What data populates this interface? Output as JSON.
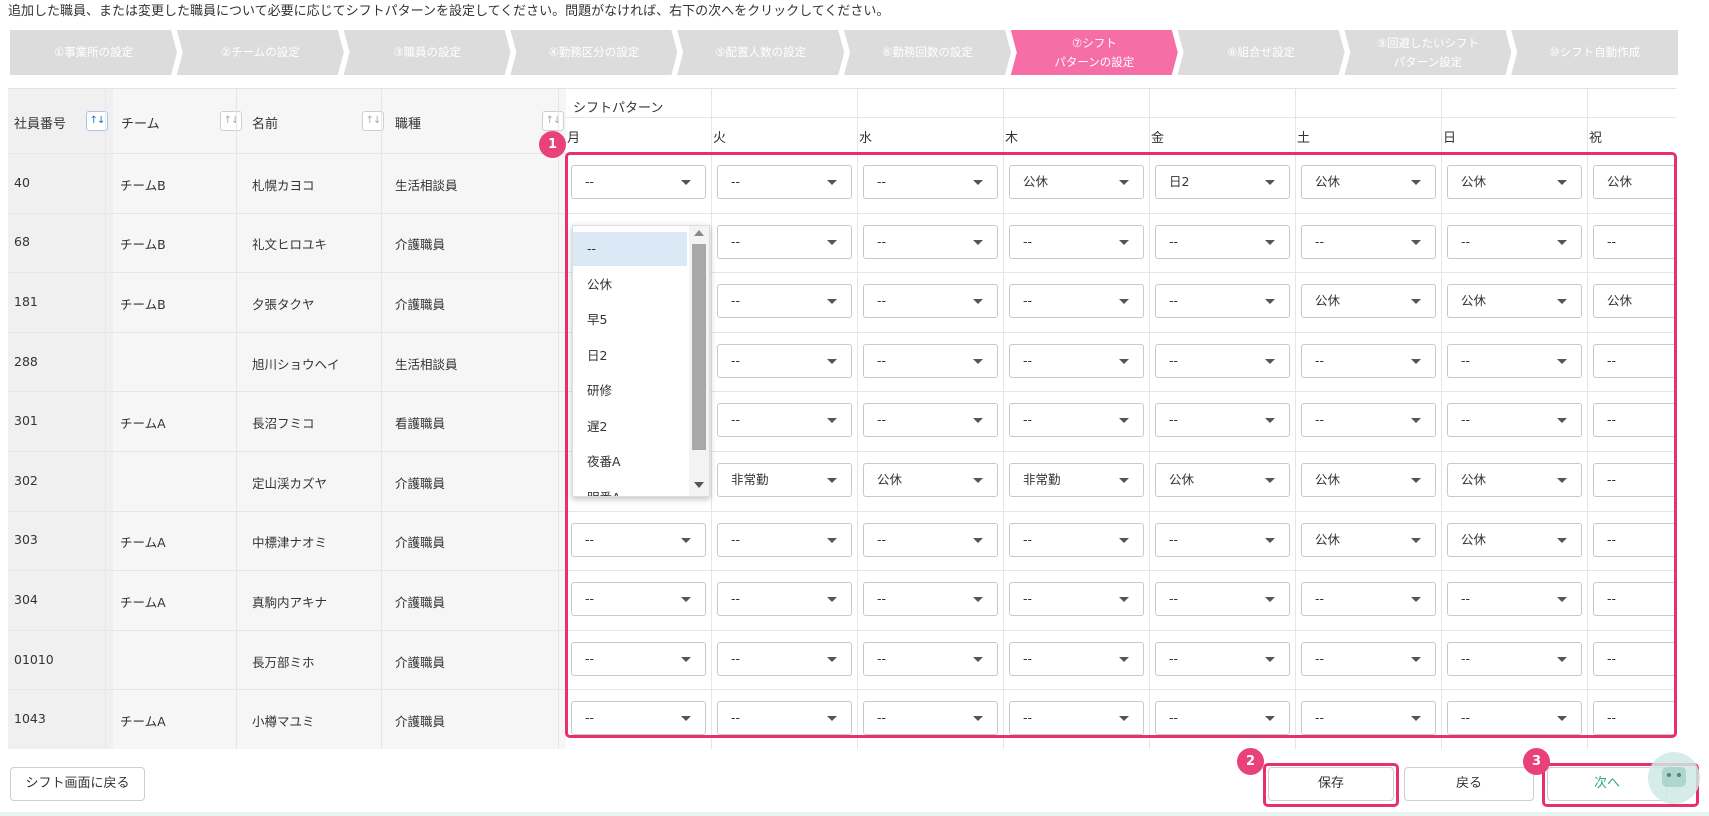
{
  "instruction": "追加した職員、または変更した職員について必要に応じてシフトパターンを設定してください。問題がなければ、右下の次へをクリックしてください。",
  "steps": [
    {
      "label": "①事業所の設定"
    },
    {
      "label": "②チームの設定"
    },
    {
      "label": "③職員の設定"
    },
    {
      "label": "④勤務区分の設定"
    },
    {
      "label": "⑤配置人数の設定"
    },
    {
      "label": "⑥勤務回数の設定"
    },
    {
      "label": "⑦シフトパターンの設定",
      "active": true
    },
    {
      "label": "⑧組合せ設定"
    },
    {
      "label": "⑨回避したいシフトパターン設定"
    },
    {
      "label": "⑩シフト自動作成"
    }
  ],
  "table": {
    "headers": {
      "id": "社員番号",
      "team": "チーム",
      "name": "名前",
      "job": "職種",
      "shift_pattern": "シフトパターン"
    },
    "days": [
      "月",
      "火",
      "水",
      "木",
      "金",
      "土",
      "日",
      "祝"
    ],
    "rows": [
      {
        "id": "40",
        "team": "チームB",
        "name": "札幌カヨコ",
        "job": "生活相談員",
        "shifts": [
          "--",
          "--",
          "--",
          "公休",
          "日2",
          "公休",
          "公休",
          "公休"
        ]
      },
      {
        "id": "68",
        "team": "チームB",
        "name": "礼文ヒロユキ",
        "job": "介護職員",
        "shifts": [
          "--",
          "--",
          "--",
          "--",
          "--",
          "--",
          "--",
          "--"
        ]
      },
      {
        "id": "181",
        "team": "チームB",
        "name": "夕張タクヤ",
        "job": "介護職員",
        "shifts": [
          "--",
          "--",
          "--",
          "--",
          "--",
          "公休",
          "公休",
          "公休"
        ]
      },
      {
        "id": "288",
        "team": "",
        "name": "旭川ショウヘイ",
        "job": "生活相談員",
        "shifts": [
          "--",
          "--",
          "--",
          "--",
          "--",
          "--",
          "--",
          "--"
        ]
      },
      {
        "id": "301",
        "team": "チームA",
        "name": "長沼フミコ",
        "job": "看護職員",
        "shifts": [
          "--",
          "--",
          "--",
          "--",
          "--",
          "--",
          "--",
          "--"
        ]
      },
      {
        "id": "302",
        "team": "",
        "name": "定山渓カズヤ",
        "job": "介護職員",
        "shifts": [
          "--",
          "非常勤",
          "公休",
          "非常勤",
          "公休",
          "公休",
          "公休",
          "--"
        ]
      },
      {
        "id": "303",
        "team": "チームA",
        "name": "中標津ナオミ",
        "job": "介護職員",
        "shifts": [
          "--",
          "--",
          "--",
          "--",
          "--",
          "公休",
          "公休",
          "--"
        ]
      },
      {
        "id": "304",
        "team": "チームA",
        "name": "真駒内アキナ",
        "job": "介護職員",
        "shifts": [
          "--",
          "--",
          "--",
          "--",
          "--",
          "--",
          "--",
          "--"
        ]
      },
      {
        "id": "01010",
        "team": "",
        "name": "長万部ミホ",
        "job": "介護職員",
        "shifts": [
          "--",
          "--",
          "--",
          "--",
          "--",
          "--",
          "--",
          "--"
        ]
      },
      {
        "id": "1043",
        "team": "チームA",
        "name": "小樽マユミ",
        "job": "介護職員",
        "shifts": [
          "--",
          "--",
          "--",
          "--",
          "--",
          "--",
          "--",
          "--"
        ]
      }
    ]
  },
  "dropdown": {
    "options": [
      "--",
      "公休",
      "早5",
      "日2",
      "研修",
      "遅2",
      "夜番A",
      "明番A"
    ],
    "selected": "--"
  },
  "badges": [
    "1",
    "2",
    "3"
  ],
  "footer": {
    "back_to_shift": "シフト画面に戻る",
    "save": "保存",
    "back": "戻る",
    "next": "次へ"
  },
  "colors": {
    "active_step": "#f56fa6",
    "highlight": "#e8306f",
    "next_text": "#2aa88a"
  }
}
